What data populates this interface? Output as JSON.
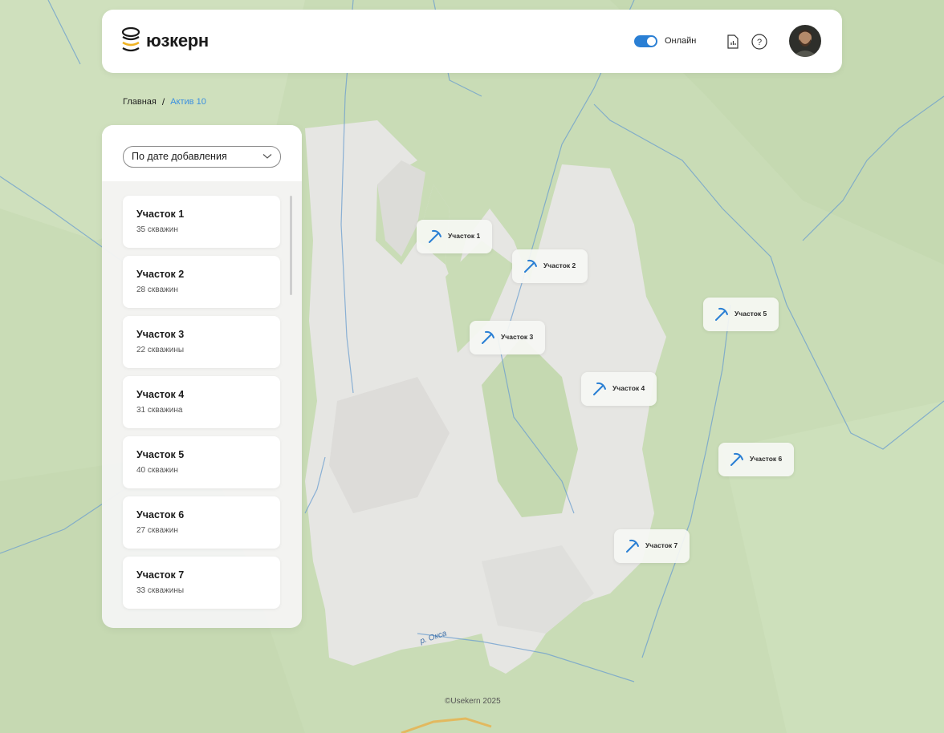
{
  "header": {
    "logo_text": "юзкерн",
    "logo_icon": "stacked-layers-logo",
    "online_toggle": {
      "label": "Онлайн",
      "on": true
    },
    "icons": [
      "report-icon",
      "help-icon",
      "avatar"
    ],
    "accent_color": "#2a7fd4"
  },
  "breadcrumb": {
    "home": "Главная",
    "separator": "/",
    "current": "Актив 10"
  },
  "sidebar": {
    "sort_select": {
      "value": "По дате добавления"
    },
    "items": [
      {
        "title": "Участок 1",
        "subtitle": "35 скважин"
      },
      {
        "title": "Участок 2",
        "subtitle": "28 скважин"
      },
      {
        "title": "Участок 3",
        "subtitle": "22 скважины"
      },
      {
        "title": "Участок 4",
        "subtitle": "31 скважина"
      },
      {
        "title": "Участок 5",
        "subtitle": "40 скважин"
      },
      {
        "title": "Участок 6",
        "subtitle": "27 скважин"
      },
      {
        "title": "Участок 7",
        "subtitle": "33 скважины"
      }
    ]
  },
  "map": {
    "markers": [
      {
        "label": "Участок 1",
        "icon": "pickaxe-icon"
      },
      {
        "label": "Участок 2",
        "icon": "pickaxe-icon"
      },
      {
        "label": "Участок 3",
        "icon": "pickaxe-icon"
      },
      {
        "label": "Участок 4",
        "icon": "pickaxe-icon"
      },
      {
        "label": "Участок 5",
        "icon": "pickaxe-icon"
      },
      {
        "label": "Участок 6",
        "icon": "pickaxe-icon"
      },
      {
        "label": "Участок 7",
        "icon": "pickaxe-icon"
      }
    ],
    "river_label": "р. Окса",
    "land_color": "#c9dcb6",
    "mountain_color": "#e6e6e3",
    "river_color": "#6b9ecf"
  },
  "footer": {
    "copyright": "©Usekern 2025"
  }
}
